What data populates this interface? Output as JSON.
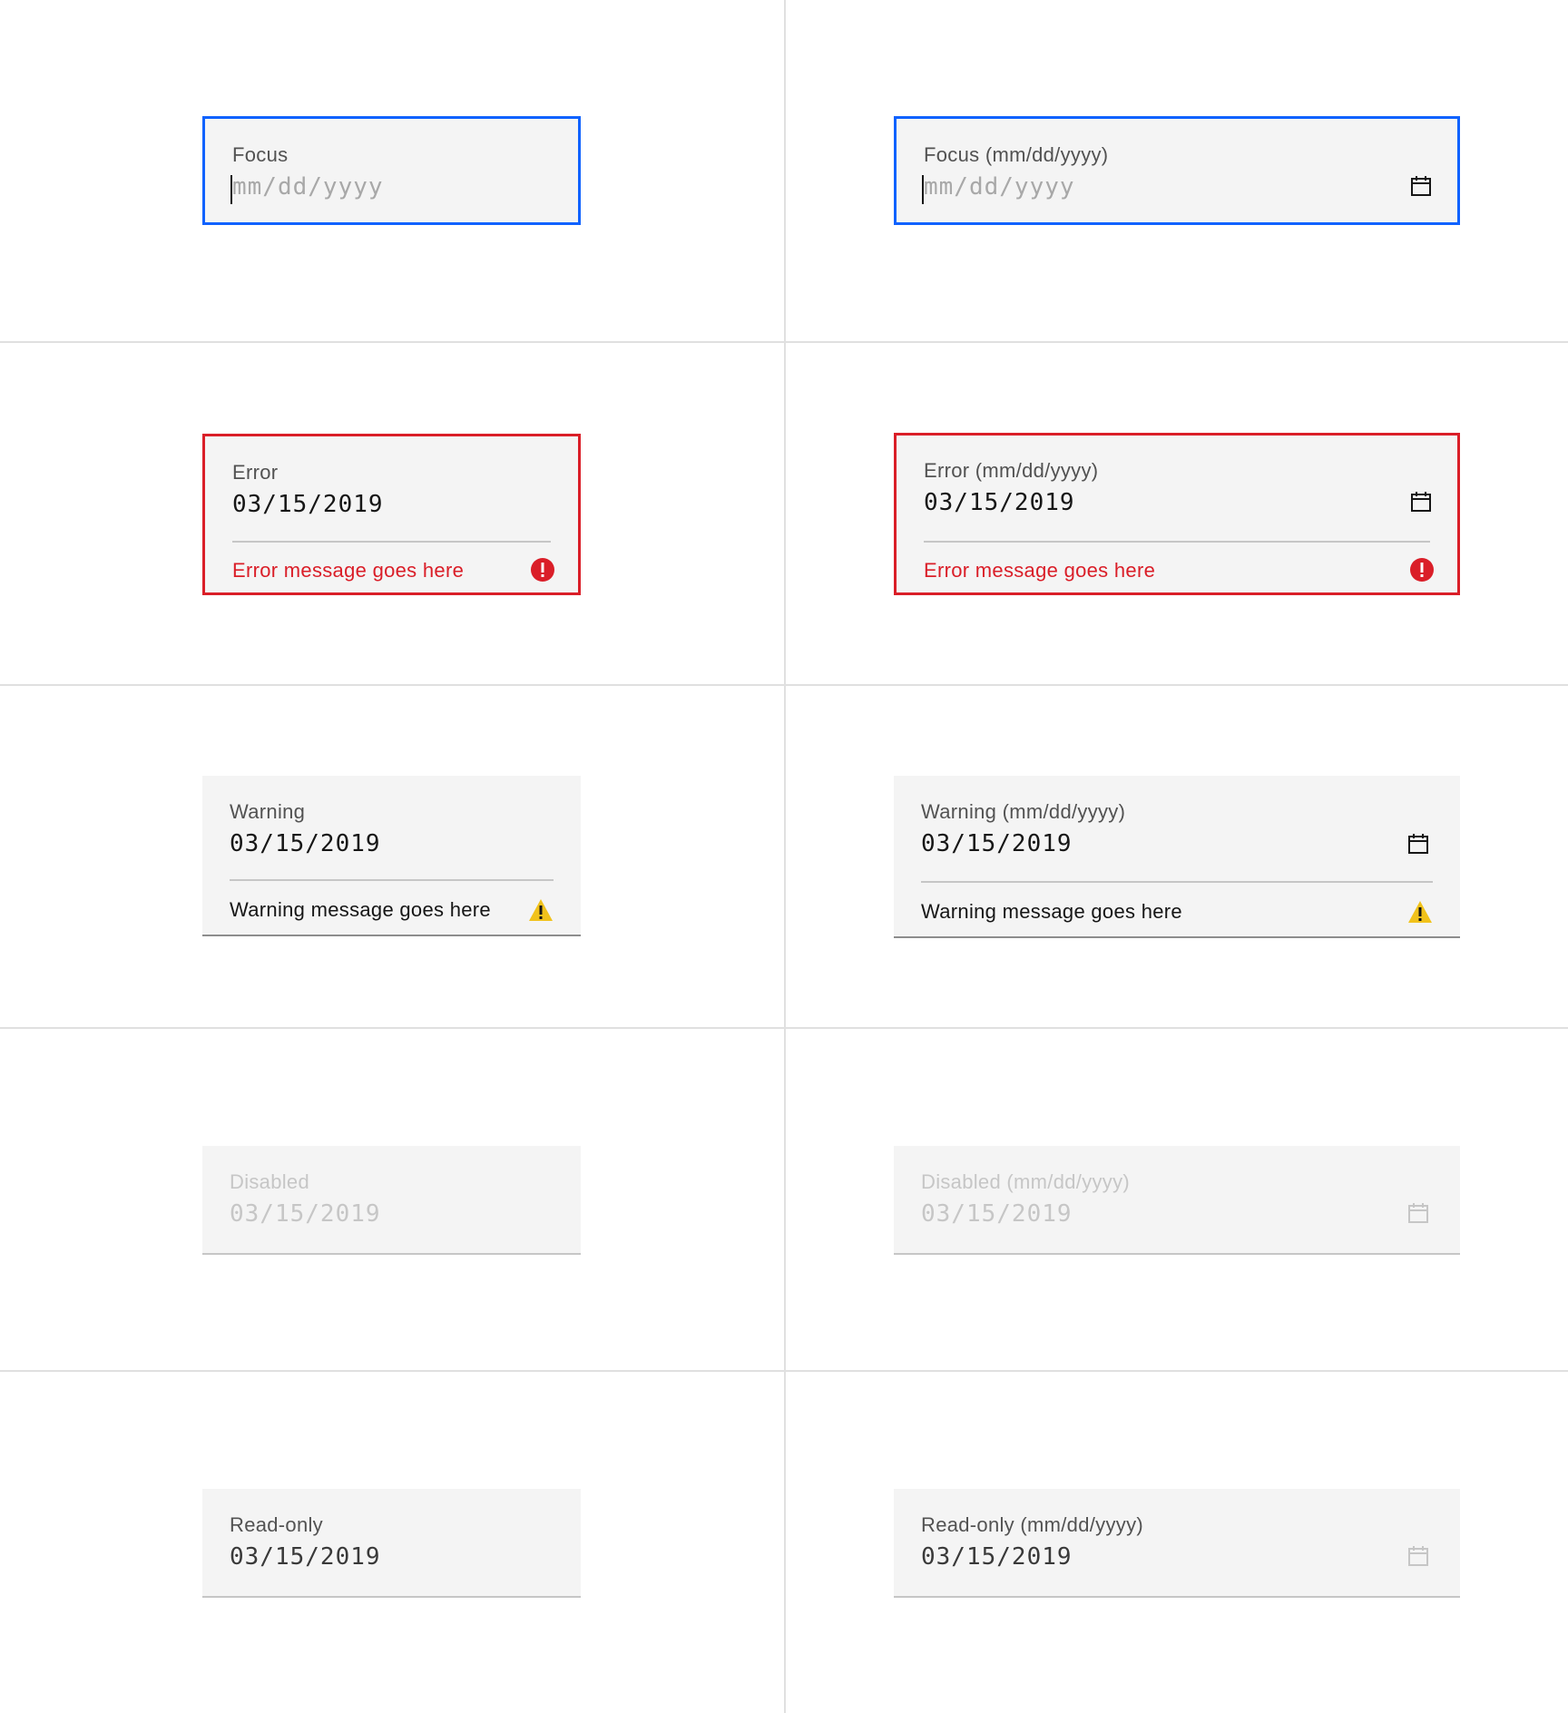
{
  "colors": {
    "focus": "#0f62fe",
    "error": "#da1e28",
    "warning": "#f1c21b",
    "field_bg": "#f4f4f4",
    "text": "#161616",
    "label": "#525252",
    "disabled": "#c6c6c6"
  },
  "rows": {
    "focus": {
      "simple": {
        "label": "Focus",
        "placeholder": "mm/dd/yyyy"
      },
      "picker": {
        "label": "Focus (mm/dd/yyyy)",
        "placeholder": "mm/dd/yyyy",
        "icon": "calendar-icon"
      }
    },
    "error": {
      "simple": {
        "label": "Error",
        "value": "03/15/2019",
        "message": "Error message goes here",
        "icon": "error-filled-icon"
      },
      "picker": {
        "label": "Error (mm/dd/yyyy)",
        "value": "03/15/2019",
        "message": "Error message goes here",
        "icon": "calendar-icon"
      }
    },
    "warning": {
      "simple": {
        "label": "Warning",
        "value": "03/15/2019",
        "message": "Warning message goes here",
        "icon": "warning-filled-icon"
      },
      "picker": {
        "label": "Warning (mm/dd/yyyy)",
        "value": "03/15/2019",
        "message": "Warning message goes here",
        "icon": "calendar-icon"
      }
    },
    "disabled": {
      "simple": {
        "label": "Disabled",
        "value": "03/15/2019"
      },
      "picker": {
        "label": "Disabled (mm/dd/yyyy)",
        "value": "03/15/2019",
        "icon": "calendar-icon"
      }
    },
    "readonly": {
      "simple": {
        "label": "Read-only",
        "value": "03/15/2019"
      },
      "picker": {
        "label": "Read-only (mm/dd/yyyy)",
        "value": "03/15/2019",
        "icon": "calendar-icon"
      }
    }
  }
}
